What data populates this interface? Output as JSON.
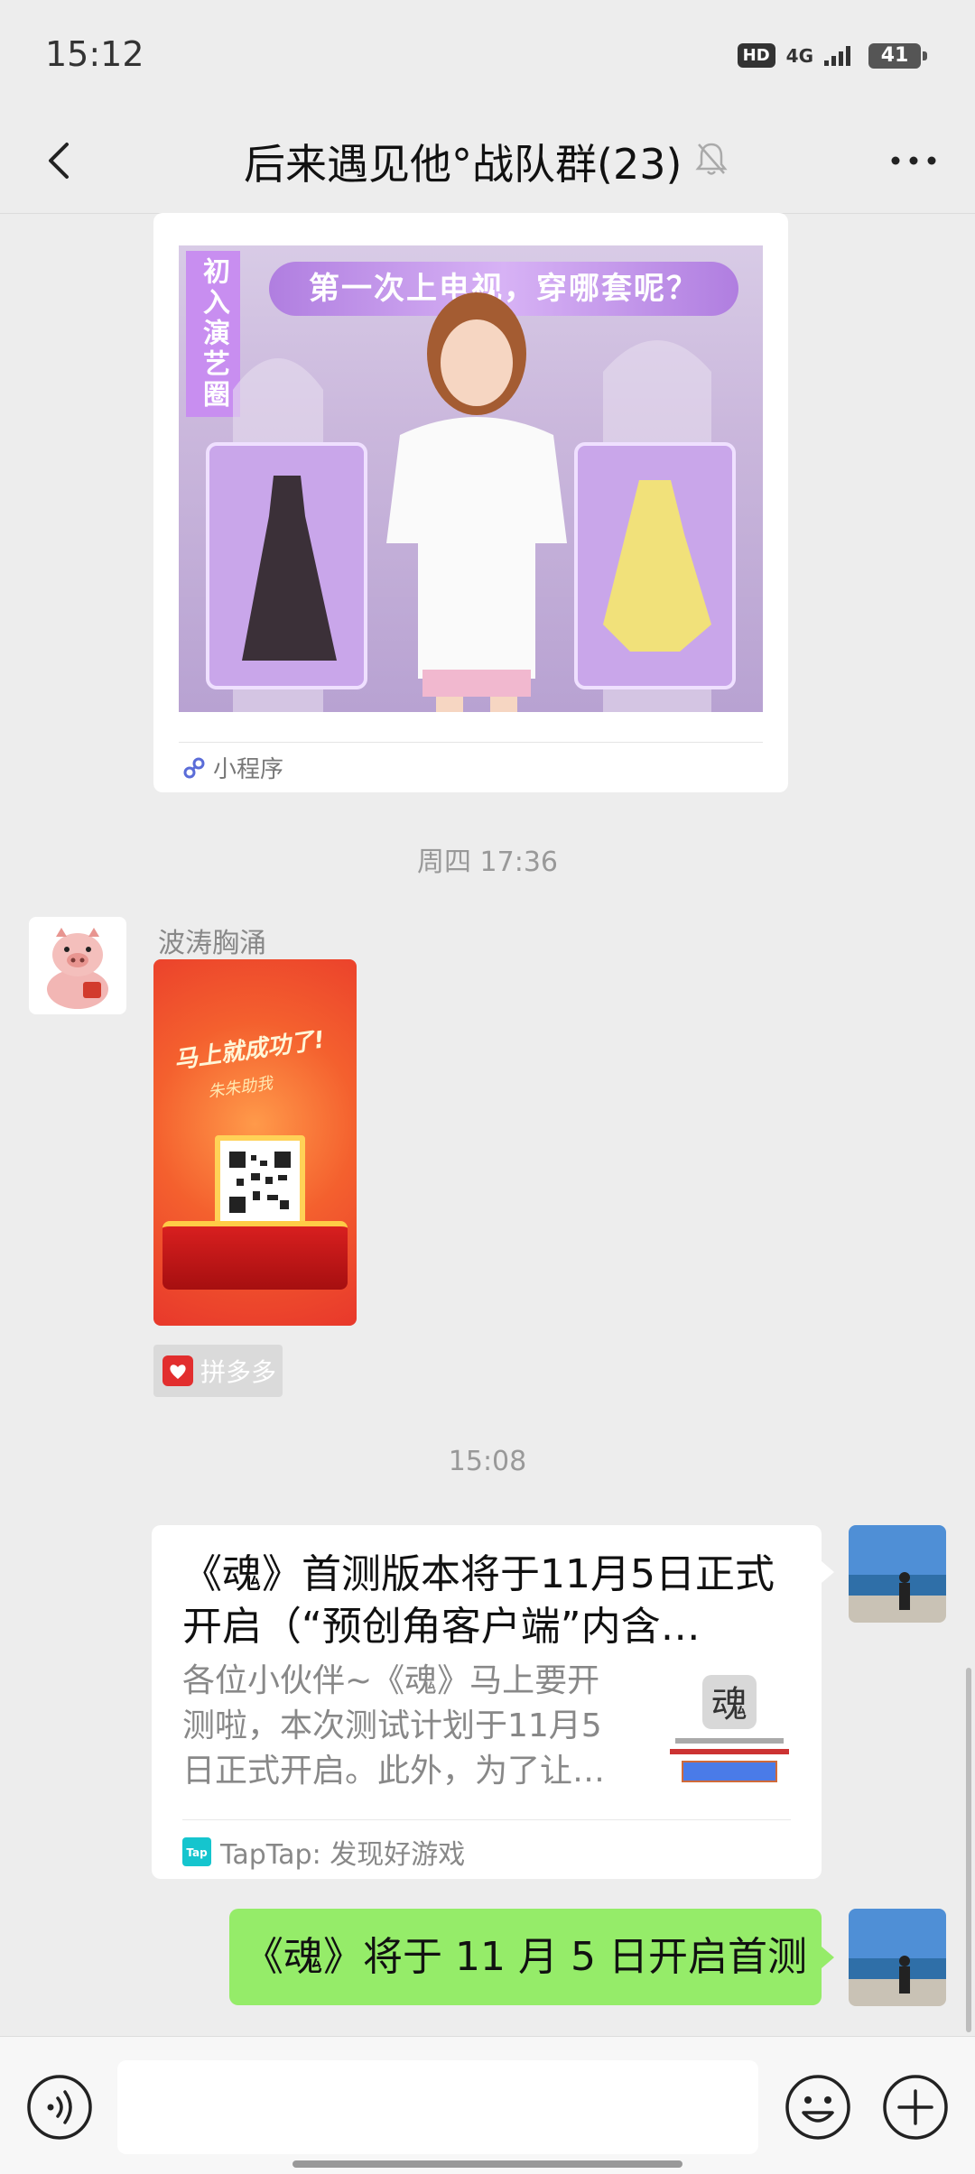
{
  "status_bar": {
    "time": "15:12",
    "hd": "HD",
    "network": "4G",
    "battery": "41"
  },
  "header": {
    "title": "后来遇见他°战队群(23)",
    "icons": [
      "back-icon",
      "mute-icon",
      "more-icon"
    ]
  },
  "messages": {
    "mini_program": {
      "banner": "第一次上电视，穿哪套呢？",
      "vertical_text": "初入演艺圈",
      "footer_label": "小程序"
    },
    "time_1": "周四 17:36",
    "sender_name": "波涛胸涌",
    "poster": {
      "title": "马上就成功了!",
      "subtitle": "朱朱助我"
    },
    "app_tag": "拼多多",
    "time_2": "15:08",
    "link_card": {
      "title": "《魂》首测版本将于11月5日正式开启（“预创角客户端”内含…",
      "description": "各位小伙伴~《魂》马上要开测啦，本次测试计划于11月5日正式开启。此外，为了让…",
      "footer": "TapTap: 发现好游戏"
    },
    "text_message": "《魂》将于 11 月 5 日开启首测"
  },
  "input_bar": {
    "placeholder": "",
    "icons": [
      "voice-icon",
      "emoji-icon",
      "plus-icon"
    ]
  },
  "colors": {
    "background": "#ededed",
    "bubble_green": "#95ec69",
    "card_white": "#ffffff"
  }
}
